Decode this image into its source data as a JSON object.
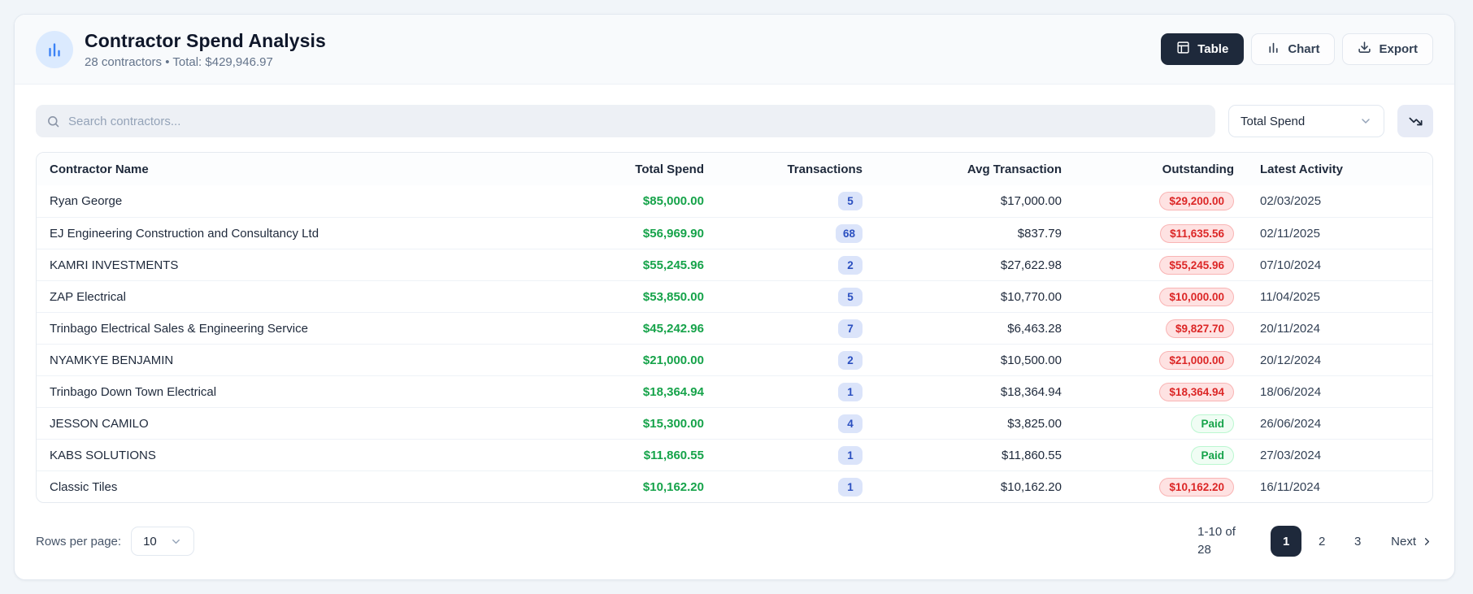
{
  "header": {
    "title": "Contractor Spend Analysis",
    "subtitle": "28 contractors • Total: $429,946.97",
    "view_buttons": [
      {
        "label": "Table",
        "icon": "table-icon",
        "active": true
      },
      {
        "label": "Chart",
        "icon": "bar-chart-icon",
        "active": false
      },
      {
        "label": "Export",
        "icon": "download-icon",
        "active": false
      }
    ]
  },
  "toolbar": {
    "search_placeholder": "Search contractors...",
    "sort_select_value": "Total Spend",
    "sort_direction": "descending"
  },
  "table": {
    "columns": [
      "Contractor Name",
      "Total Spend",
      "Transactions",
      "Avg Transaction",
      "Outstanding",
      "Latest Activity"
    ],
    "rows": [
      {
        "name": "Ryan George",
        "total_spend": "$85,000.00",
        "transactions": "5",
        "avg_transaction": "$17,000.00",
        "outstanding": "$29,200.00",
        "paid": false,
        "latest_activity": "02/03/2025"
      },
      {
        "name": "EJ Engineering Construction and Consultancy Ltd",
        "total_spend": "$56,969.90",
        "transactions": "68",
        "avg_transaction": "$837.79",
        "outstanding": "$11,635.56",
        "paid": false,
        "latest_activity": "02/11/2025"
      },
      {
        "name": "KAMRI INVESTMENTS",
        "total_spend": "$55,245.96",
        "transactions": "2",
        "avg_transaction": "$27,622.98",
        "outstanding": "$55,245.96",
        "paid": false,
        "latest_activity": "07/10/2024"
      },
      {
        "name": "ZAP Electrical",
        "total_spend": "$53,850.00",
        "transactions": "5",
        "avg_transaction": "$10,770.00",
        "outstanding": "$10,000.00",
        "paid": false,
        "latest_activity": "11/04/2025"
      },
      {
        "name": "Trinbago Electrical Sales & Engineering Service",
        "total_spend": "$45,242.96",
        "transactions": "7",
        "avg_transaction": "$6,463.28",
        "outstanding": "$9,827.70",
        "paid": false,
        "latest_activity": "20/11/2024"
      },
      {
        "name": "NYAMKYE BENJAMIN",
        "total_spend": "$21,000.00",
        "transactions": "2",
        "avg_transaction": "$10,500.00",
        "outstanding": "$21,000.00",
        "paid": false,
        "latest_activity": "20/12/2024"
      },
      {
        "name": "Trinbago Down Town Electrical",
        "total_spend": "$18,364.94",
        "transactions": "1",
        "avg_transaction": "$18,364.94",
        "outstanding": "$18,364.94",
        "paid": false,
        "latest_activity": "18/06/2024"
      },
      {
        "name": "JESSON CAMILO",
        "total_spend": "$15,300.00",
        "transactions": "4",
        "avg_transaction": "$3,825.00",
        "outstanding": "Paid",
        "paid": true,
        "latest_activity": "26/06/2024"
      },
      {
        "name": "KABS SOLUTIONS",
        "total_spend": "$11,860.55",
        "transactions": "1",
        "avg_transaction": "$11,860.55",
        "outstanding": "Paid",
        "paid": true,
        "latest_activity": "27/03/2024"
      },
      {
        "name": "Classic Tiles",
        "total_spend": "$10,162.20",
        "transactions": "1",
        "avg_transaction": "$10,162.20",
        "outstanding": "$10,162.20",
        "paid": false,
        "latest_activity": "16/11/2024"
      }
    ]
  },
  "footer": {
    "rows_per_page_label": "Rows per page:",
    "rows_per_page_value": "10",
    "range_text": "1-10 of 28",
    "pages": [
      "1",
      "2",
      "3"
    ],
    "active_page": "1",
    "next_label": "Next"
  },
  "colors": {
    "accent_dark": "#1e293b",
    "spend_green": "#16a34a",
    "transactions_pill_bg": "#dbe4fa",
    "transactions_pill_text": "#2a4fc0",
    "outstanding_badge_bg": "#fee2e2",
    "outstanding_badge_text": "#dc2626",
    "paid_badge_bg": "#f0fdf4",
    "paid_badge_text": "#16a34a",
    "header_icon_bg": "#dbeafe",
    "header_icon_color": "#3b82f6"
  }
}
